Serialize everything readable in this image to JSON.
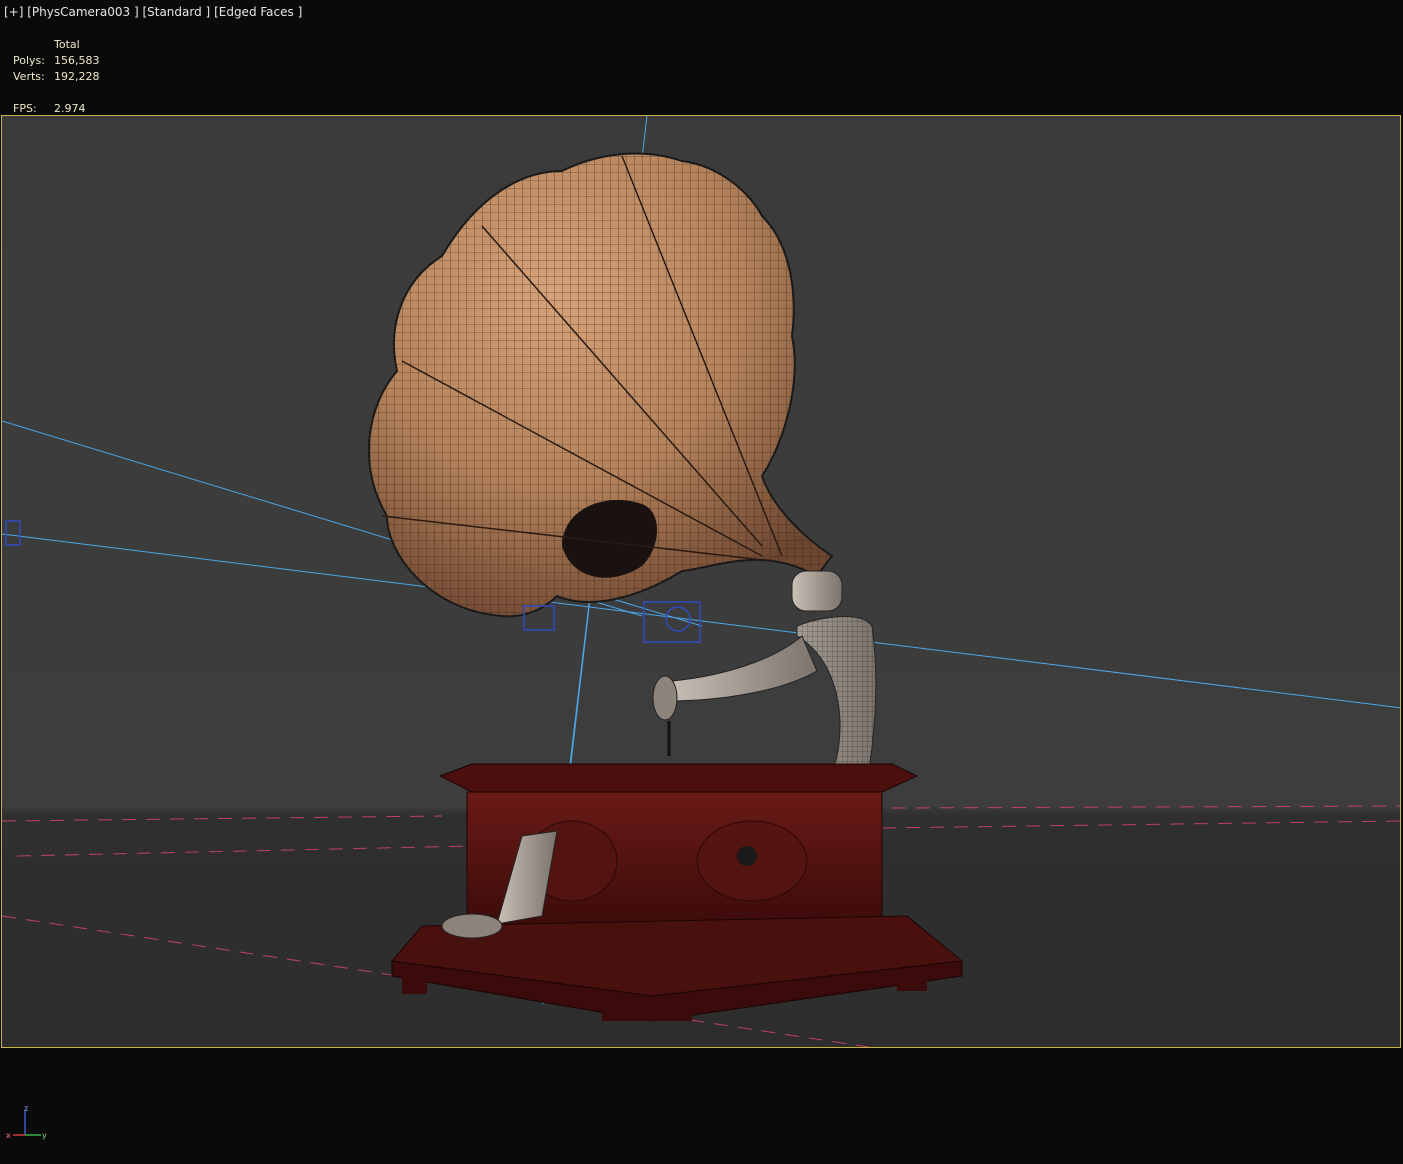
{
  "viewport": {
    "label_plus": "[+]",
    "label_camera": "[PhysCamera003 ]",
    "label_shading": "[Standard ]",
    "label_mode": "[Edged Faces ]"
  },
  "stats": {
    "header": "Total",
    "polys_label": "Polys:",
    "polys_value": "156,583",
    "verts_label": "Verts:",
    "verts_value": "192,228",
    "fps_label": "FPS:",
    "fps_value": "2.974"
  },
  "gizmo": {
    "x": "x",
    "y": "y",
    "z": "z"
  },
  "colors": {
    "safe_frame": "#c7b34a",
    "horn": "#b88458",
    "base_wood": "#5a1412",
    "arm_metal": "#9a8f86",
    "camera_lines": "#4aa6e8",
    "grid_red": "#c0406a"
  }
}
